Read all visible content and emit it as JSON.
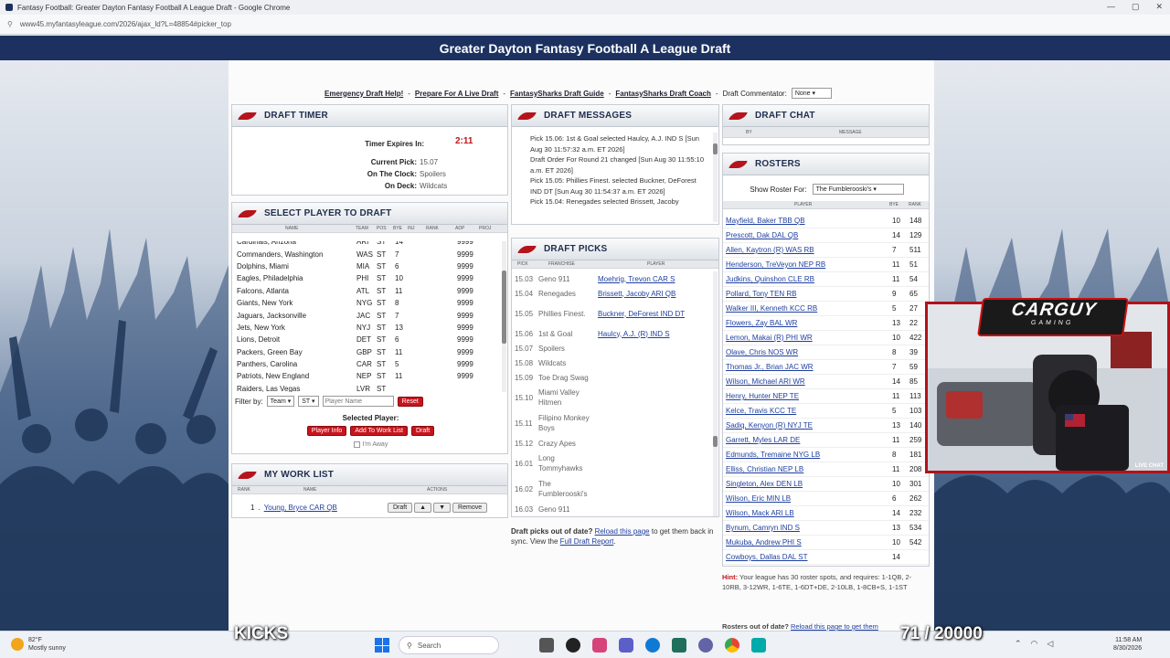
{
  "browser": {
    "title": "Fantasy Football: Greater Dayton Fantasy Football A League Draft - Google Chrome",
    "url": "www45.myfantasyleague.com/2026/ajax_ld?L=48854#picker_top",
    "window_controls": [
      "—",
      "▢",
      "✕"
    ]
  },
  "banner": {
    "title": "Greater Dayton Fantasy Football A League Draft"
  },
  "links": {
    "items": [
      "Emergency Draft Help!",
      "Prepare For A Live Draft",
      "FantasySharks Draft Guide",
      "FantasySharks Draft Coach"
    ],
    "commentator_label": "Draft Commentator:",
    "commentator_value": "None"
  },
  "draft_timer": {
    "title": "DRAFT TIMER",
    "expires_label": "Timer Expires In:",
    "expires_value": "2:11",
    "current_pick_label": "Current Pick:",
    "current_pick_value": "15.07",
    "on_clock_label": "On The Clock:",
    "on_clock_value": "Spoilers",
    "on_deck_label": "On Deck:",
    "on_deck_value": "Wildcats"
  },
  "select_player": {
    "title": "SELECT PLAYER TO DRAFT",
    "columns": [
      "NAME",
      "TEAM",
      "POS",
      "BYE",
      "INJ",
      "RANK",
      "ADP",
      "PROJ"
    ],
    "rows": [
      {
        "name": "Cardinals, Arizona",
        "team": "ARI",
        "pos": "ST",
        "bye": "14",
        "adp": "9999"
      },
      {
        "name": "Commanders, Washington",
        "team": "WAS",
        "pos": "ST",
        "bye": "7",
        "adp": "9999"
      },
      {
        "name": "Dolphins, Miami",
        "team": "MIA",
        "pos": "ST",
        "bye": "6",
        "adp": "9999"
      },
      {
        "name": "Eagles, Philadelphia",
        "team": "PHI",
        "pos": "ST",
        "bye": "10",
        "adp": "9999"
      },
      {
        "name": "Falcons, Atlanta",
        "team": "ATL",
        "pos": "ST",
        "bye": "11",
        "adp": "9999"
      },
      {
        "name": "Giants, New York",
        "team": "NYG",
        "pos": "ST",
        "bye": "8",
        "adp": "9999"
      },
      {
        "name": "Jaguars, Jacksonville",
        "team": "JAC",
        "pos": "ST",
        "bye": "7",
        "adp": "9999"
      },
      {
        "name": "Jets, New York",
        "team": "NYJ",
        "pos": "ST",
        "bye": "13",
        "adp": "9999"
      },
      {
        "name": "Lions, Detroit",
        "team": "DET",
        "pos": "ST",
        "bye": "6",
        "adp": "9999"
      },
      {
        "name": "Packers, Green Bay",
        "team": "GBP",
        "pos": "ST",
        "bye": "11",
        "adp": "9999"
      },
      {
        "name": "Panthers, Carolina",
        "team": "CAR",
        "pos": "ST",
        "bye": "5",
        "adp": "9999"
      },
      {
        "name": "Patriots, New England",
        "team": "NEP",
        "pos": "ST",
        "bye": "11",
        "adp": "9999"
      },
      {
        "name": "Raiders, Las Vegas",
        "team": "LVR",
        "pos": "ST",
        "bye": "",
        "adp": ""
      }
    ],
    "filter_label": "Filter by:",
    "filter_team": "Team",
    "filter_pos": "ST",
    "filter_name_placeholder": "Player Name",
    "reset_label": "Reset",
    "selected_label": "Selected Player:",
    "btn_info": "Player Info",
    "btn_worklist": "Add To Work List",
    "btn_draft": "Draft",
    "away_label": "I'm Away"
  },
  "work_list": {
    "title": "MY WORK LIST",
    "columns": [
      "RANK",
      "NAME",
      "ACTIONS"
    ],
    "item_rank": "1",
    "item_name": "Young, Bryce CAR QB",
    "btn_draft": "Draft",
    "btn_up": "▲",
    "btn_down": "▼",
    "btn_remove": "Remove"
  },
  "draft_messages": {
    "title": "DRAFT MESSAGES",
    "items": [
      "Pick 15.06: 1st & Goal selected Haulcy, A.J. IND S [Sun Aug 30 11:57:32 a.m. ET 2026]",
      "Draft Order For Round 21 changed [Sun Aug 30 11:55:10 a.m. ET 2026]",
      "Pick 15.05: Phillies Finest. selected Buckner, DeForest IND DT [Sun Aug 30 11:54:37 a.m. ET 2026]",
      "Pick 15.04: Renegades selected Brissett, Jacoby"
    ]
  },
  "draft_picks": {
    "title": "DRAFT PICKS",
    "columns": [
      "PICK",
      "FRANCHISE",
      "PLAYER"
    ],
    "rows": [
      {
        "pick": "15.03",
        "franchise": "Geno 911",
        "player": "Moehrig, Trevon CAR S"
      },
      {
        "pick": "15.04",
        "franchise": "Renegades",
        "player": "Brissett, Jacoby ARI QB"
      },
      {
        "pick": "15.05",
        "franchise": "Phillies Finest.",
        "player": "Buckner, DeForest IND DT"
      },
      {
        "pick": "15.06",
        "franchise": "1st & Goal",
        "player": "Haulcy, A.J. (R) IND S"
      },
      {
        "pick": "15.07",
        "franchise": "Spoilers",
        "player": ""
      },
      {
        "pick": "15.08",
        "franchise": "Wildcats",
        "player": ""
      },
      {
        "pick": "15.09",
        "franchise": "Toe Drag Swag",
        "player": ""
      },
      {
        "pick": "15.10",
        "franchise": "Miami Valley Hitmen",
        "player": ""
      },
      {
        "pick": "15.11",
        "franchise": "Filipino Monkey Boys",
        "player": ""
      },
      {
        "pick": "15.12",
        "franchise": "Crazy Apes",
        "player": ""
      },
      {
        "pick": "16.01",
        "franchise": "Long Tommyhawks",
        "player": ""
      },
      {
        "pick": "16.02",
        "franchise": "The Fumblerooski's",
        "player": ""
      },
      {
        "pick": "16.03",
        "franchise": "Geno 911",
        "player": ""
      }
    ],
    "footer_bold": "Draft picks out of date?",
    "footer_link1": "Reload this page",
    "footer_mid": "to get them back in sync. View the",
    "footer_link2": "Full Draft Report",
    "footer_end": "."
  },
  "draft_chat": {
    "title": "DRAFT CHAT",
    "columns": [
      "BY",
      "MESSAGE"
    ]
  },
  "rosters": {
    "title": "ROSTERS",
    "show_label": "Show Roster For:",
    "show_value": "The Fumblerooski's",
    "columns": [
      "PLAYER",
      "BYE",
      "RANK"
    ],
    "rows": [
      {
        "player": "Mayfield, Baker TBB QB",
        "bye": "10",
        "rank": "148"
      },
      {
        "player": "Prescott, Dak DAL QB",
        "bye": "14",
        "rank": "129"
      },
      {
        "player": "Allen, Kaytron (R) WAS RB",
        "bye": "7",
        "rank": "511"
      },
      {
        "player": "Henderson, TreVeyon NEP RB",
        "bye": "11",
        "rank": "51"
      },
      {
        "player": "Judkins, Quinshon CLE RB",
        "bye": "11",
        "rank": "54"
      },
      {
        "player": "Pollard, Tony TEN RB",
        "bye": "9",
        "rank": "65"
      },
      {
        "player": "Walker III, Kenneth KCC RB",
        "bye": "5",
        "rank": "27"
      },
      {
        "player": "Flowers, Zay BAL WR",
        "bye": "13",
        "rank": "22"
      },
      {
        "player": "Lemon, Makai (R) PHI WR",
        "bye": "10",
        "rank": "422"
      },
      {
        "player": "Olave, Chris NOS WR",
        "bye": "8",
        "rank": "39"
      },
      {
        "player": "Thomas Jr., Brian JAC WR",
        "bye": "7",
        "rank": "59"
      },
      {
        "player": "Wilson, Michael ARI WR",
        "bye": "14",
        "rank": "85"
      },
      {
        "player": "Henry, Hunter NEP TE",
        "bye": "11",
        "rank": "113"
      },
      {
        "player": "Kelce, Travis KCC TE",
        "bye": "5",
        "rank": "103"
      },
      {
        "player": "Sadiq, Kenyon (R) NYJ TE",
        "bye": "13",
        "rank": "140"
      },
      {
        "player": "Garrett, Myles LAR DE",
        "bye": "11",
        "rank": "259"
      },
      {
        "player": "Edmunds, Tremaine NYG LB",
        "bye": "8",
        "rank": "181"
      },
      {
        "player": "Elliss, Christian NEP LB",
        "bye": "11",
        "rank": "208"
      },
      {
        "player": "Singleton, Alex DEN LB",
        "bye": "10",
        "rank": "301"
      },
      {
        "player": "Wilson, Eric MIN LB",
        "bye": "6",
        "rank": "262"
      },
      {
        "player": "Wilson, Mack ARI LB",
        "bye": "14",
        "rank": "232"
      },
      {
        "player": "Bynum, Camryn IND S",
        "bye": "13",
        "rank": "534"
      },
      {
        "player": "Mukuba, Andrew PHI S",
        "bye": "10",
        "rank": "542"
      },
      {
        "player": "Cowboys, Dallas DAL ST",
        "bye": "14",
        "rank": ""
      }
    ],
    "hint_label": "Hint:",
    "hint_text": "Your league has 30 roster spots, and requires: 1-1QB, 2-10RB, 3-12WR, 1-6TE, 1-6DT+DE, 2-10LB, 1-8CB+S, 1-1ST",
    "footer_bold": "Rosters out of date?",
    "footer_text": "Reload this page to get them"
  },
  "stream": {
    "brand_top": "CARGUY",
    "brand_bottom": "GAMING",
    "live_chat": "LIVE CHAT",
    "kicks": "KICKS",
    "counter": "71 / 20000"
  },
  "taskbar": {
    "weather_temp": "82°F",
    "weather_desc": "Mostly sunny",
    "search": "Search",
    "time": "11:58 AM",
    "date": "8/30/2026"
  },
  "colors": {
    "banner": "#1c3160",
    "accent_red": "#c8141c",
    "link": "#1f3fa0"
  }
}
